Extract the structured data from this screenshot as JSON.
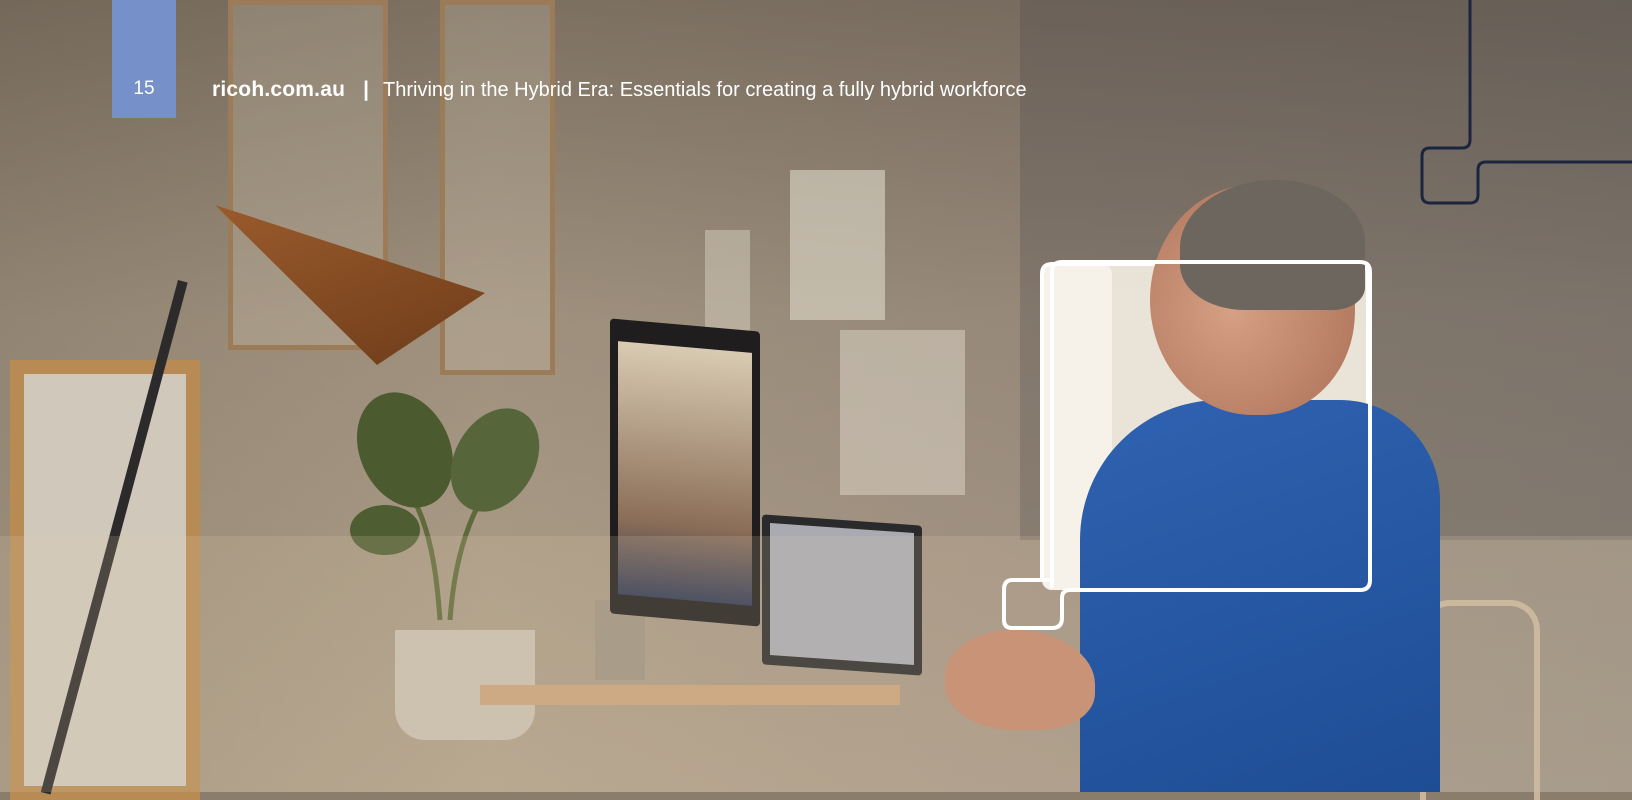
{
  "header": {
    "page_number": "15",
    "site": "ricoh.com.au",
    "separator": "|",
    "title": "Thriving in the Hybrid Era: Essentials for creating a fully hybrid workforce"
  },
  "colors": {
    "page_tab": "#7691c9",
    "deco_line": "#1b2540",
    "callout_outline": "#ffffff",
    "header_text": "#ffffff"
  }
}
